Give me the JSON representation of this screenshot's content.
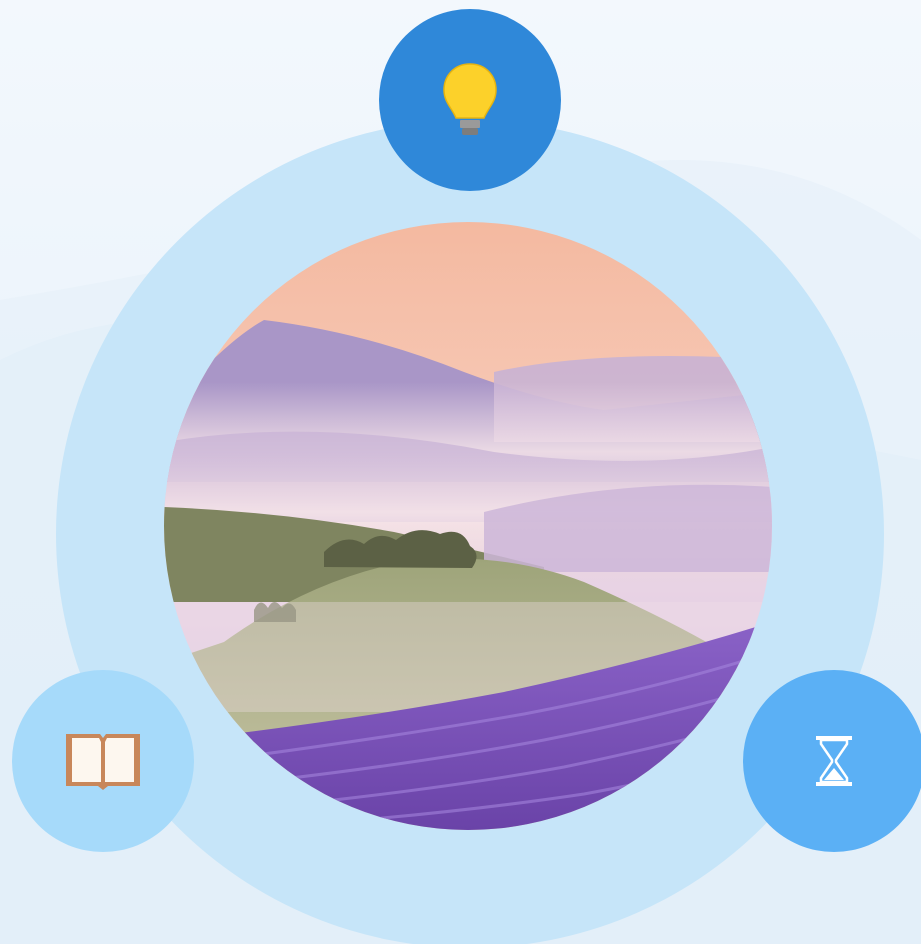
{
  "colors": {
    "background": "#eef5fc",
    "ring": "#c6e5f9",
    "node_top": "#2f88d9",
    "node_left": "#a6dafa",
    "node_right": "#5bb0f5",
    "bulb": "#fcd12a",
    "book": "#c8875a",
    "hourglass": "#ffffff"
  },
  "nodes": [
    {
      "id": "idea",
      "icon": "lightbulb-icon"
    },
    {
      "id": "learning",
      "icon": "open-book-icon"
    },
    {
      "id": "time",
      "icon": "hourglass-icon"
    }
  ],
  "center_image": {
    "icon": "lavender-hills-landscape"
  }
}
